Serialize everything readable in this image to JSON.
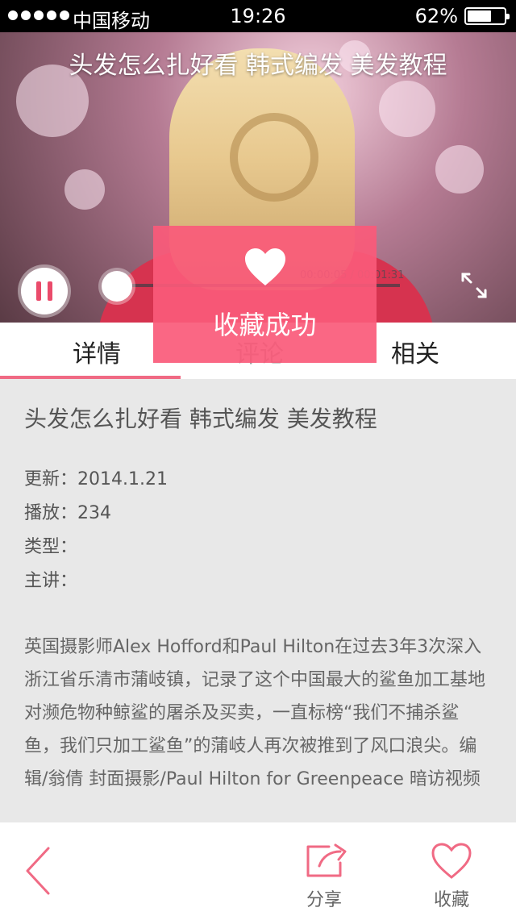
{
  "status_bar": {
    "carrier": "中国移动",
    "time": "19:26",
    "battery_percent": "62%"
  },
  "video": {
    "title": "头发怎么扎好看 韩式编发 美发教程",
    "timecode": "00:00:05 / 00:01:31",
    "progress_fraction": 0.05
  },
  "toast": {
    "message": "收藏成功"
  },
  "tabs": [
    {
      "label": "详情"
    },
    {
      "label": "评论"
    },
    {
      "label": "相关"
    }
  ],
  "details": {
    "title": "头发怎么扎好看 韩式编发 美发教程",
    "update": "更新：2014.1.21",
    "plays": "播放：234",
    "type": "类型：",
    "presenter": "主讲：",
    "description": "英国摄影师Alex Hofford和Paul Hilton在过去3年3次深入浙江省乐清市蒲岐镇，记录了这个中国最大的鲨鱼加工基地对濒危物种鲸鲨的屠杀及买卖，一直标榜“我们不捕杀鲨鱼，我们只加工鲨鱼”的蒲岐人再次被推到了风口浪尖。编辑/翁倩 封面摄影/Paul Hilton for Greenpeace 暗访视频"
  },
  "bottom_bar": {
    "share_label": "分享",
    "favorite_label": "收藏"
  },
  "colors": {
    "accent": "#f06a84",
    "toast_bg": "#fa5a7a"
  }
}
